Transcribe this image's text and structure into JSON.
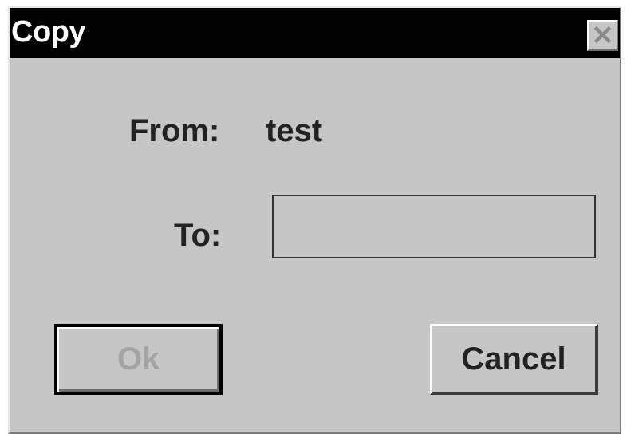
{
  "window": {
    "title": "Copy",
    "close_glyph": "✕"
  },
  "form": {
    "from_label": "From:",
    "from_value": "test",
    "to_label": "To:",
    "to_value": ""
  },
  "buttons": {
    "ok_label": "Ok",
    "cancel_label": "Cancel"
  },
  "colors": {
    "titlebar": "#000000",
    "dialog_bg": "#c6c6c6",
    "disabled_text": "#a4a4a4"
  },
  "icons": {
    "close": "close-icon"
  }
}
